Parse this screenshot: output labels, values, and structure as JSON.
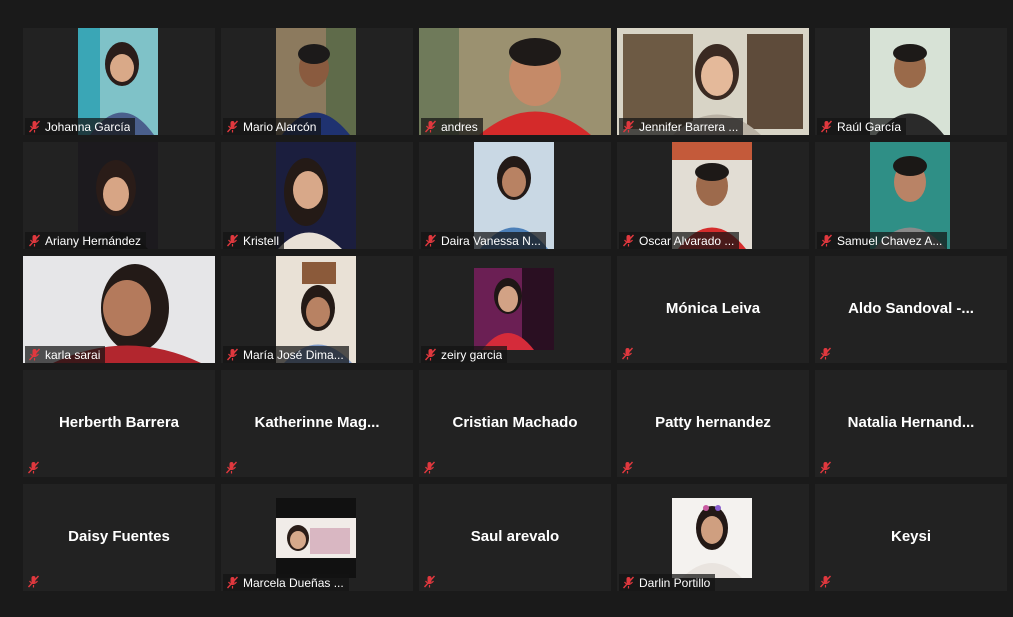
{
  "participants": [
    {
      "name": "Johanna García",
      "video": true
    },
    {
      "name": "Mario Alarcón",
      "video": true
    },
    {
      "name": "andres",
      "video": true
    },
    {
      "name": "Jennifer Barrera ...",
      "video": true
    },
    {
      "name": "Raúl García",
      "video": true
    },
    {
      "name": "Ariany Hernández",
      "video": true
    },
    {
      "name": "Kristell",
      "video": true
    },
    {
      "name": "Daira Vanessa N...",
      "video": true
    },
    {
      "name": "Oscar Alvarado ...",
      "video": true
    },
    {
      "name": "Samuel Chavez A...",
      "video": true
    },
    {
      "name": "karla sarai",
      "video": true
    },
    {
      "name": "María José Dima...",
      "video": true
    },
    {
      "name": "zeiry garcia",
      "video": true
    },
    {
      "name": "Mónica Leiva",
      "video": false
    },
    {
      "name": "Aldo  Sandoval  -...",
      "video": false
    },
    {
      "name": "Herberth Barrera",
      "video": false
    },
    {
      "name": "Katherinne  Mag...",
      "video": false
    },
    {
      "name": "Cristian Machado",
      "video": false
    },
    {
      "name": "Patty hernandez",
      "video": false
    },
    {
      "name": "Natalia  Hernand...",
      "video": false
    },
    {
      "name": "Daisy Fuentes",
      "video": false
    },
    {
      "name": "Marcela Dueñas ...",
      "video": true
    },
    {
      "name": "Saul arevalo",
      "video": false
    },
    {
      "name": "Darlin Portillo",
      "video": true
    },
    {
      "name": "Keysi",
      "video": false
    }
  ],
  "colors": {
    "background": "#1a1a1a",
    "tile": "#222222",
    "muted_mic": "#e0383e"
  },
  "icons": {
    "mic": "muted-mic-icon",
    "person": "person-silhouette"
  }
}
